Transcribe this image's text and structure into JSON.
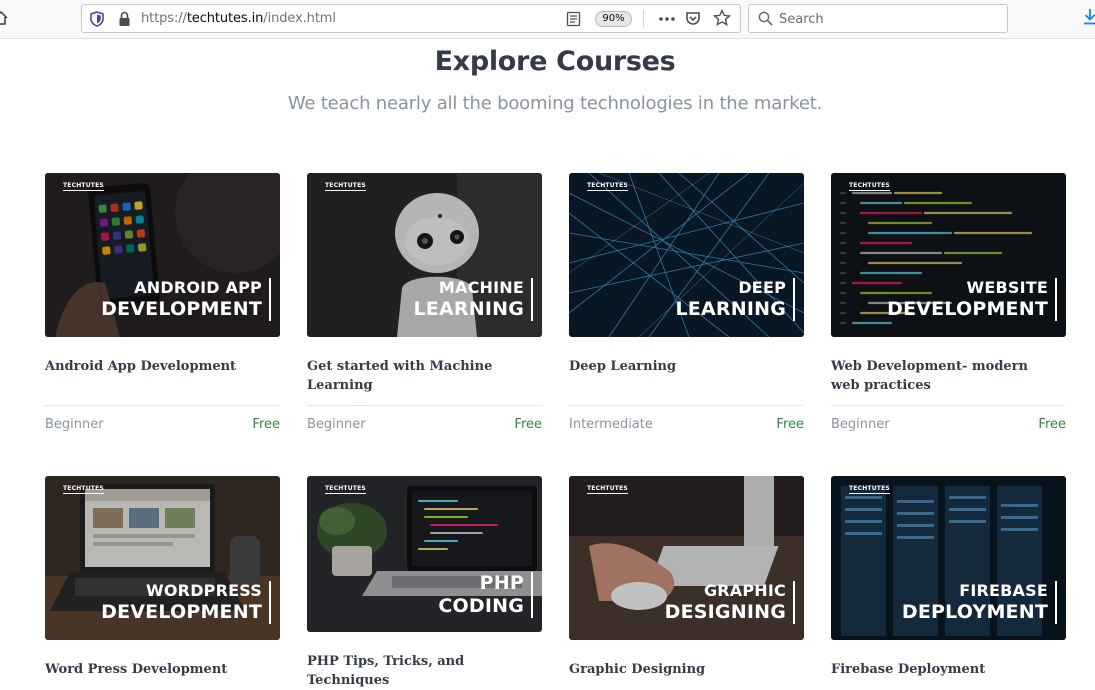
{
  "browser": {
    "url_prefix": "https://",
    "url_host": "techtutes.in",
    "url_path": "/index.html",
    "zoom": "90%",
    "search_placeholder": "Search"
  },
  "page": {
    "title": "Explore Courses",
    "subtitle": "We teach nearly all the booming technologies in the market."
  },
  "courses": [
    {
      "brand": "TECHTUTES",
      "overlay_line1": "ANDROID APP",
      "overlay_line2": "DEVELOPMENT",
      "title": "Android App Development",
      "level": "Beginner",
      "price": "Free"
    },
    {
      "brand": "TECHTUTES",
      "overlay_line1": "MACHINE",
      "overlay_line2": "LEARNING",
      "title": "Get started with Machine Learning",
      "level": "Beginner",
      "price": "Free"
    },
    {
      "brand": "TECHTUTES",
      "overlay_line1": "DEEP",
      "overlay_line2": "LEARNING",
      "title": "Deep Learning",
      "level": "Intermediate",
      "price": "Free"
    },
    {
      "brand": "TECHTUTES",
      "overlay_line1": "WEBSITE",
      "overlay_line2": "DEVELOPMENT",
      "title": "Web Development- modern web practices",
      "level": "Beginner",
      "price": "Free"
    },
    {
      "brand": "TECHTUTES",
      "overlay_line1": "WORDPRESS",
      "overlay_line2": "DEVELOPMENT",
      "title": "Word Press Development"
    },
    {
      "brand": "TECHTUTES",
      "overlay_line1": "PHP",
      "overlay_line2": "CODING",
      "title": "PHP Tips, Tricks, and Techniques"
    },
    {
      "brand": "TECHTUTES",
      "overlay_line1": "GRAPHIC",
      "overlay_line2": "DESIGNING",
      "title": "Graphic Designing"
    },
    {
      "brand": "TECHTUTES",
      "overlay_line1": "FIREBASE",
      "overlay_line2": "DEPLOYMENT",
      "title": "Firebase Deployment"
    }
  ],
  "colors": {
    "title": "#343a48",
    "subtitle": "#8a93a3",
    "price_free": "#2e8b3e",
    "level": "#8a93a3"
  }
}
